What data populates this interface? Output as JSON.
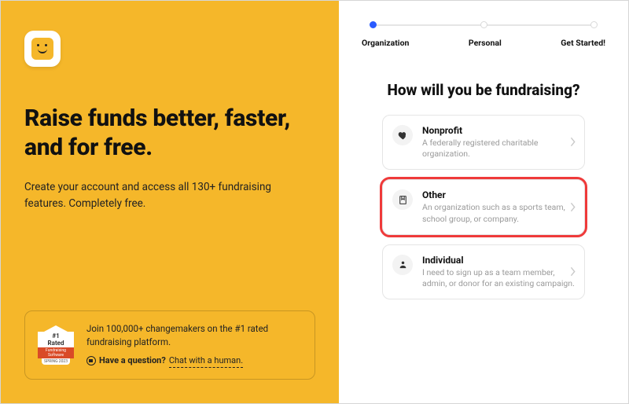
{
  "left": {
    "headline": "Raise funds better, faster, and for free.",
    "sub": "Create your account and access all 130+ fundraising features. Completely free.",
    "badge": {
      "hash": "#1",
      "rated": "Rated",
      "bar1": "Fundraising Software",
      "bar2": "SPRING 2023"
    },
    "promo": "Join 100,000+ changemakers on the #1 rated fundraising platform.",
    "q_bold": "Have a question?",
    "q_link": "Chat with a human."
  },
  "steps": [
    "Organization",
    "Personal",
    "Get Started!"
  ],
  "question": "How will you be fundraising?",
  "options": [
    {
      "title": "Nonprofit",
      "desc": "A federally registered charitable organization."
    },
    {
      "title": "Other",
      "desc": "An organization such as a sports team, school group, or company."
    },
    {
      "title": "Individual",
      "desc": "I need to sign up as a team member, admin, or donor for an existing campaign."
    }
  ]
}
